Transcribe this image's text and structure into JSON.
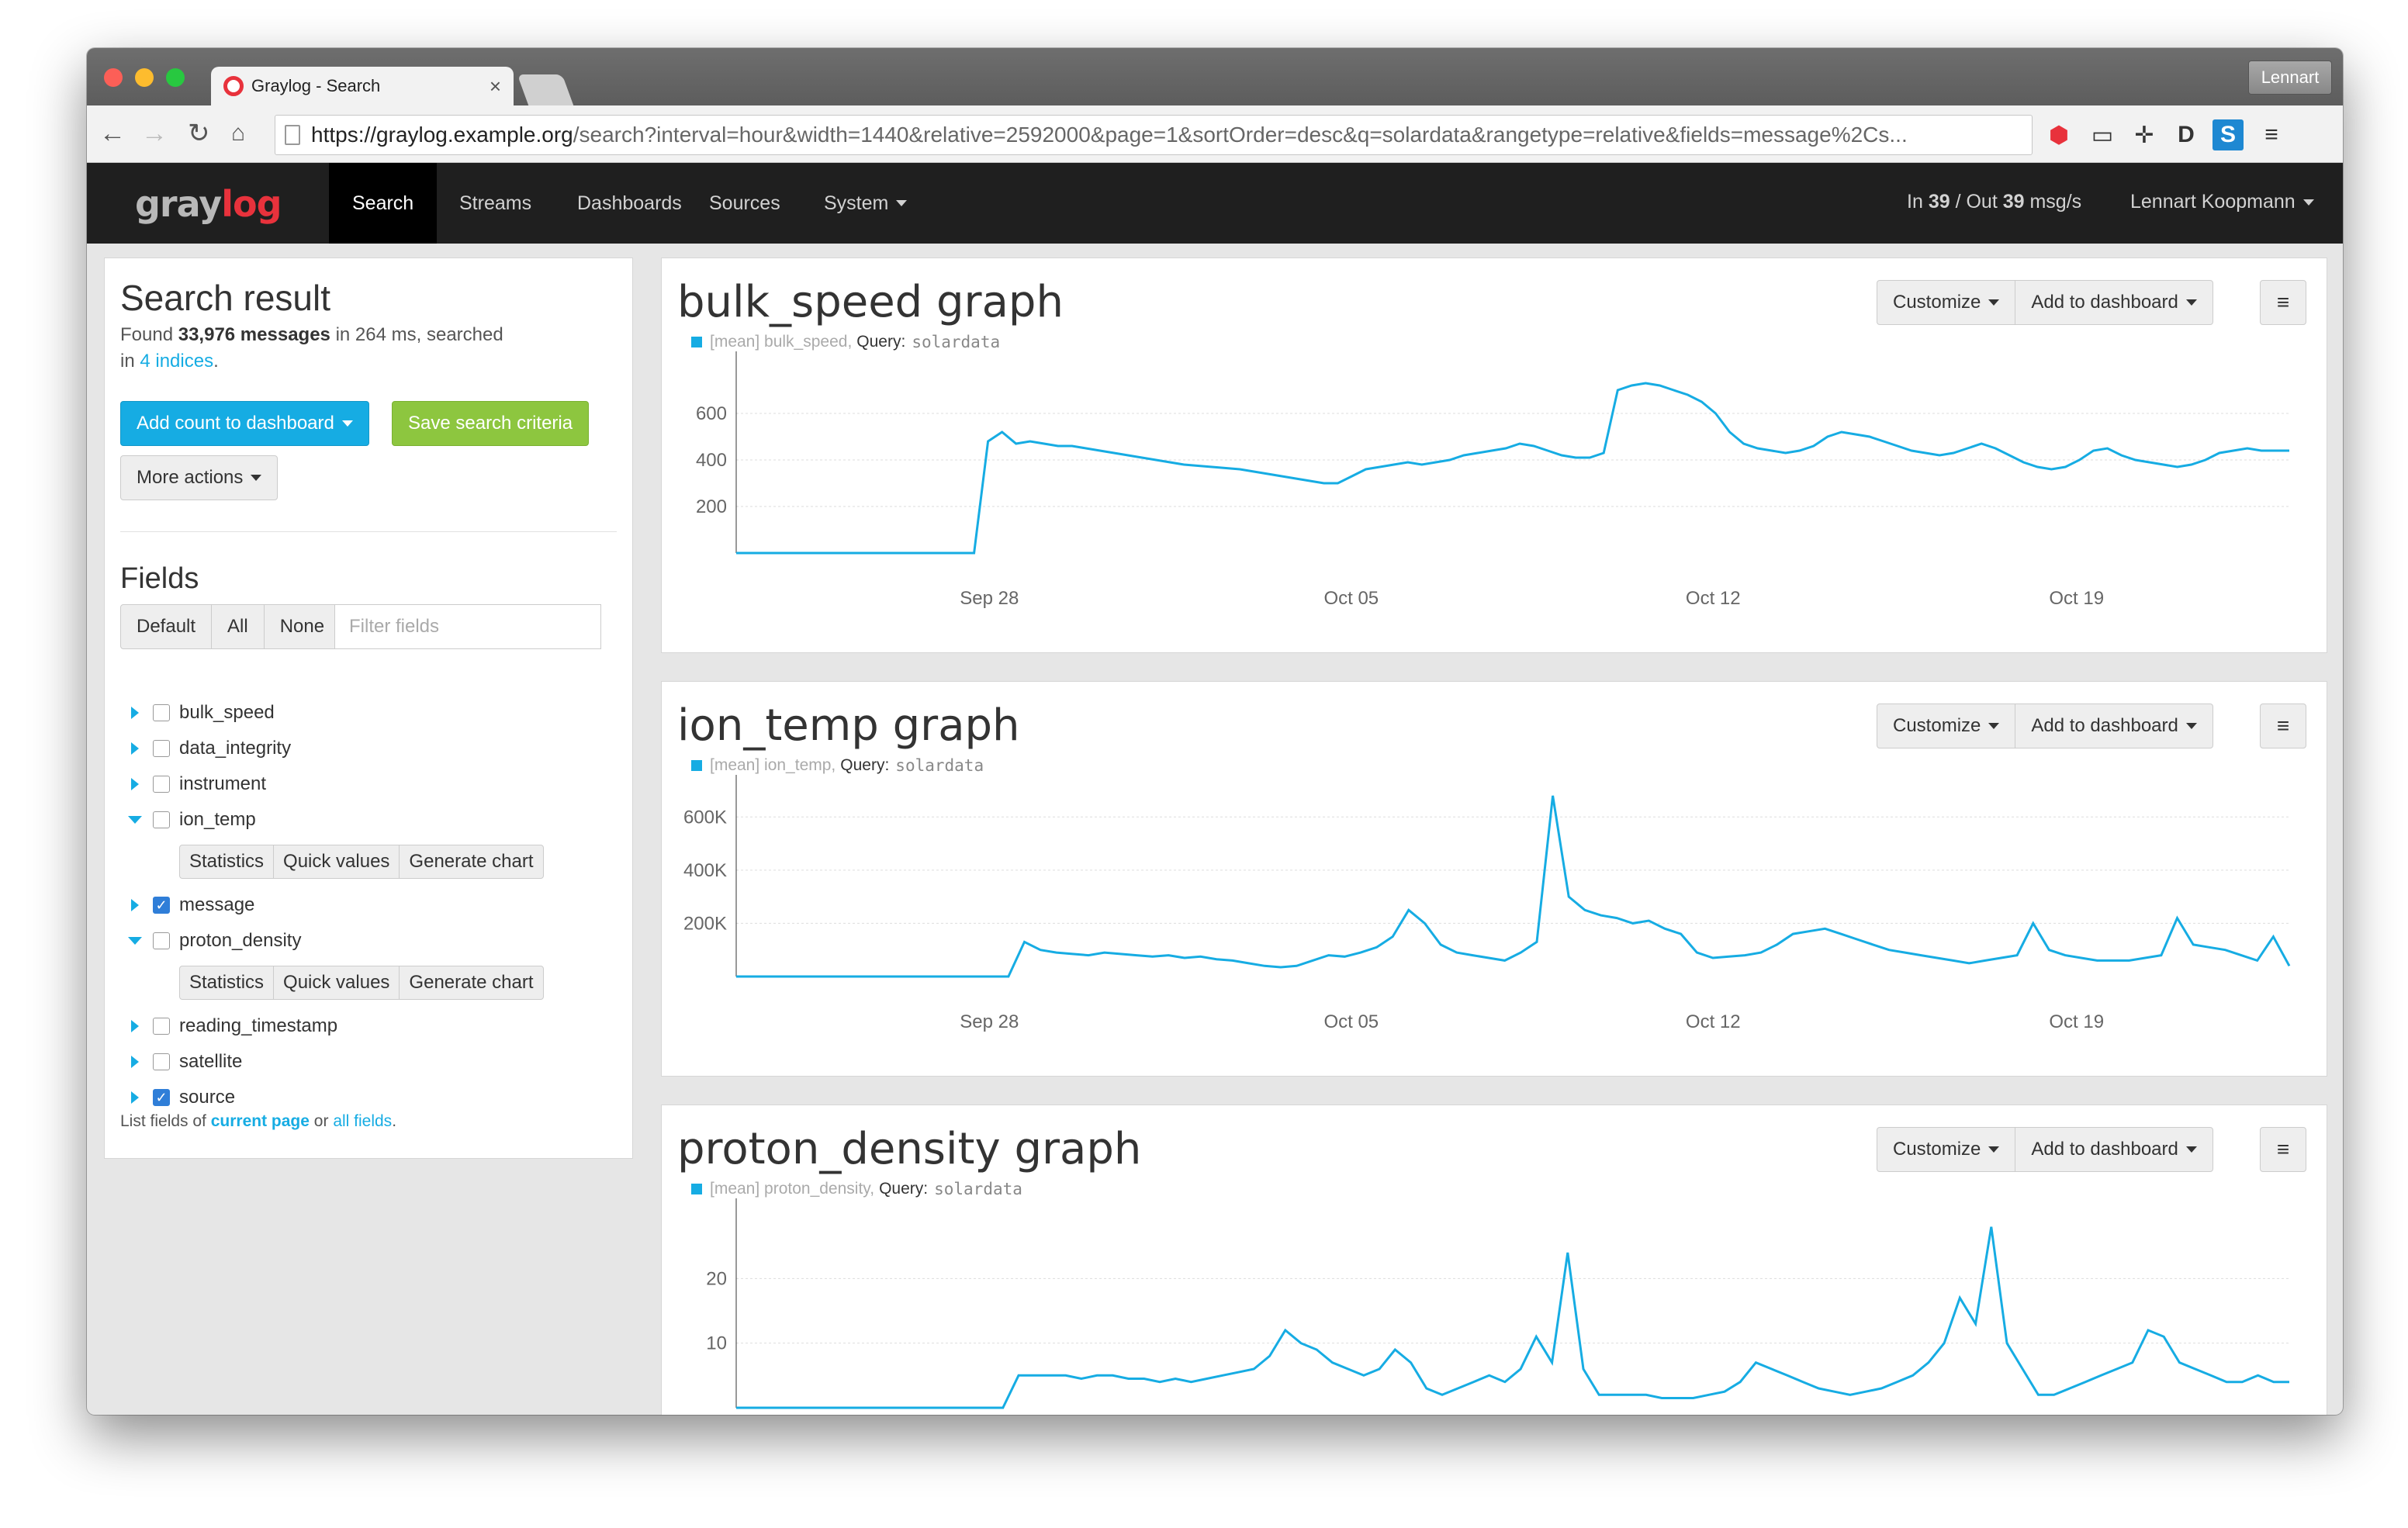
{
  "browser": {
    "tab_title": "Graylog - Search",
    "user_badge": "Lennart",
    "url_host": "https://graylog.example.org",
    "url_rest": "/search?interval=hour&width=1440&relative=2592000&page=1&sortOrder=desc&q=solardata&rangetype=relative&fields=message%2Cs..."
  },
  "nav": {
    "items": [
      "Search",
      "Streams",
      "Dashboards",
      "Sources",
      "System"
    ],
    "throughput_in_label": "In",
    "throughput_in": "39",
    "throughput_sep": "/ Out",
    "throughput_out": "39",
    "throughput_unit": "msg/s",
    "user": "Lennart Koopmann"
  },
  "sidebar": {
    "title": "Search result",
    "found_prefix": "Found",
    "found_count": "33,976 messages",
    "found_suffix": "in 264 ms, searched",
    "in_label": "in",
    "indices_link": "4 indices",
    "add_count_label": "Add count to dashboard",
    "save_label": "Save search criteria",
    "more_actions_label": "More actions",
    "fields_title": "Fields",
    "filter_buttons": [
      "Default",
      "All",
      "None"
    ],
    "filter_placeholder": "Filter fields",
    "fields": [
      {
        "name": "bulk_speed",
        "checked": false,
        "expanded": false
      },
      {
        "name": "data_integrity",
        "checked": false,
        "expanded": false
      },
      {
        "name": "instrument",
        "checked": false,
        "expanded": false
      },
      {
        "name": "ion_temp",
        "checked": false,
        "expanded": true
      },
      {
        "name": "message",
        "checked": true,
        "expanded": false
      },
      {
        "name": "proton_density",
        "checked": false,
        "expanded": true
      },
      {
        "name": "reading_timestamp",
        "checked": false,
        "expanded": false
      },
      {
        "name": "satellite",
        "checked": false,
        "expanded": false
      },
      {
        "name": "source",
        "checked": true,
        "expanded": false
      }
    ],
    "field_actions": [
      "Statistics",
      "Quick values",
      "Generate chart"
    ],
    "footer_prefix": "List fields of",
    "footer_current": "current page",
    "footer_or": "or",
    "footer_all": "all fields",
    "footer_end": "."
  },
  "graph_controls": {
    "customize": "Customize",
    "add_to_dashboard": "Add to dashboard"
  },
  "colors": {
    "accent": "#16ace3",
    "green": "#8dc63f",
    "nav": "#1f1f1f",
    "logo_red": "#e8323c"
  },
  "chart_data": [
    {
      "type": "line",
      "title": "bulk_speed graph",
      "legend": "[mean] bulk_speed,",
      "query_label": "Query:",
      "query": "solardata",
      "x_ticks": [
        "Sep 28",
        "Oct 05",
        "Oct 12",
        "Oct 19"
      ],
      "y_ticks": [
        "200",
        "400",
        "600"
      ],
      "ylim": [
        0,
        800
      ],
      "series": [
        {
          "values": [
            0,
            0,
            0,
            0,
            0,
            0,
            0,
            0,
            0,
            0,
            0,
            0,
            0,
            0,
            0,
            0,
            0,
            0,
            480,
            520,
            470,
            480,
            470,
            460,
            460,
            450,
            440,
            430,
            420,
            410,
            400,
            390,
            380,
            375,
            370,
            365,
            360,
            350,
            340,
            330,
            320,
            310,
            300,
            300,
            330,
            360,
            370,
            380,
            390,
            380,
            390,
            400,
            420,
            430,
            440,
            450,
            470,
            460,
            440,
            420,
            410,
            410,
            430,
            700,
            720,
            730,
            720,
            700,
            680,
            650,
            600,
            520,
            470,
            450,
            440,
            430,
            440,
            460,
            500,
            520,
            510,
            500,
            480,
            460,
            440,
            430,
            420,
            430,
            450,
            470,
            450,
            420,
            390,
            370,
            360,
            370,
            400,
            440,
            450,
            420,
            400,
            390,
            380,
            370,
            380,
            400,
            430,
            440,
            450,
            440,
            440,
            440
          ]
        }
      ]
    },
    {
      "type": "line",
      "title": "ion_temp graph",
      "legend": "[mean] ion_temp,",
      "query_label": "Query:",
      "query": "solardata",
      "x_ticks": [
        "Sep 28",
        "Oct 05",
        "Oct 12",
        "Oct 19"
      ],
      "y_ticks": [
        "200K",
        "400K",
        "600K"
      ],
      "ylim": [
        0,
        700000
      ],
      "series": [
        {
          "values": [
            0,
            0,
            0,
            0,
            0,
            0,
            0,
            0,
            0,
            0,
            0,
            0,
            0,
            0,
            0,
            0,
            0,
            0,
            130000,
            100000,
            90000,
            85000,
            80000,
            90000,
            85000,
            80000,
            75000,
            80000,
            70000,
            75000,
            65000,
            60000,
            50000,
            40000,
            35000,
            40000,
            60000,
            80000,
            75000,
            90000,
            110000,
            150000,
            250000,
            200000,
            120000,
            90000,
            80000,
            70000,
            60000,
            90000,
            130000,
            680000,
            300000,
            250000,
            230000,
            220000,
            200000,
            210000,
            180000,
            160000,
            90000,
            70000,
            75000,
            80000,
            90000,
            120000,
            160000,
            170000,
            180000,
            160000,
            140000,
            120000,
            100000,
            90000,
            80000,
            70000,
            60000,
            50000,
            60000,
            70000,
            80000,
            200000,
            100000,
            80000,
            70000,
            60000,
            60000,
            60000,
            70000,
            80000,
            220000,
            120000,
            110000,
            100000,
            80000,
            60000,
            150000,
            40000
          ]
        }
      ]
    },
    {
      "type": "line",
      "title": "proton_density graph",
      "legend": "[mean] proton_density,",
      "query_label": "Query:",
      "query": "solardata",
      "x_ticks": [],
      "y_ticks": [
        "10",
        "20"
      ],
      "ylim": [
        0,
        30
      ],
      "series": [
        {
          "values": [
            0,
            0,
            0,
            0,
            0,
            0,
            0,
            0,
            0,
            0,
            0,
            0,
            0,
            0,
            0,
            0,
            0,
            0,
            5,
            5,
            5,
            5,
            4.5,
            5,
            5,
            4.5,
            4.5,
            4,
            4.5,
            4,
            4.5,
            5,
            5.5,
            6,
            8,
            12,
            10,
            9,
            7,
            6,
            5,
            6,
            9,
            7,
            3,
            2,
            3,
            4,
            5,
            4,
            6,
            11,
            7,
            24,
            6,
            2,
            2,
            2,
            2,
            1.5,
            1.5,
            1.5,
            2,
            2.5,
            4,
            7,
            6,
            5,
            4,
            3,
            2.5,
            2,
            2.5,
            3,
            4,
            5,
            7,
            10,
            17,
            13,
            28,
            10,
            6,
            2,
            2,
            3,
            4,
            5,
            6,
            7,
            12,
            11,
            7,
            6,
            5,
            4,
            4,
            5,
            4,
            4
          ]
        }
      ]
    }
  ]
}
